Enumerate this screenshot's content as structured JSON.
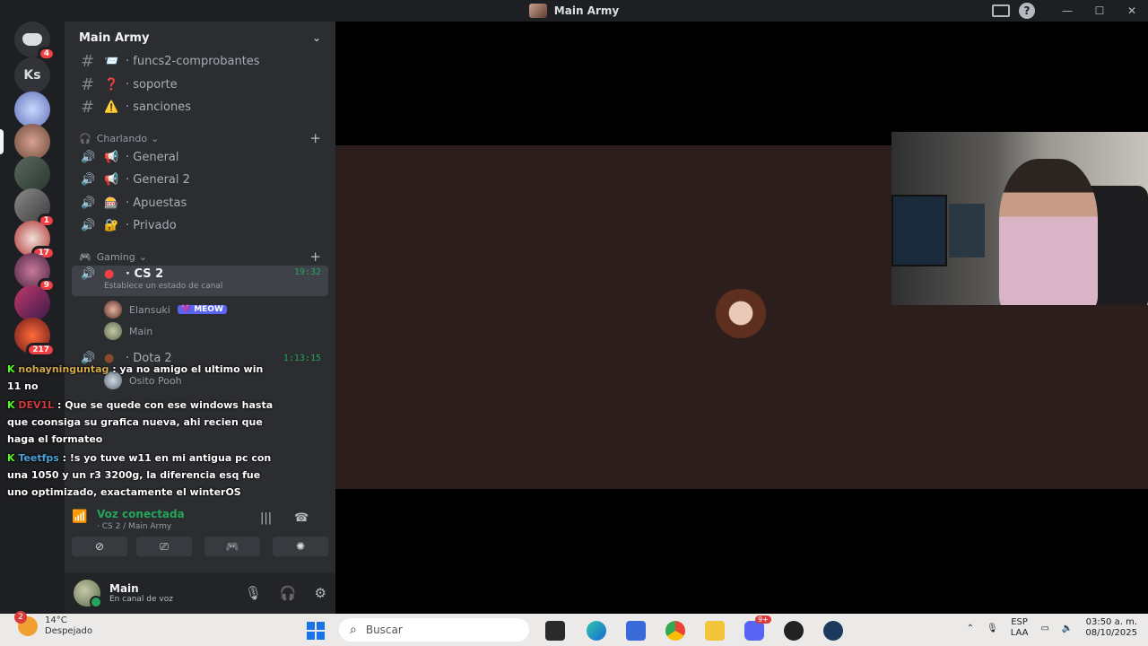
{
  "window": {
    "title": "Main Army"
  },
  "rail": {
    "dm_badge": "4",
    "ks_label": "Ks",
    "badges": [
      "1",
      "17",
      "9",
      "217"
    ]
  },
  "server": {
    "name": "Main Army",
    "text_channels": [
      {
        "emoji": "📨",
        "name": "· funcs2-comprobantes"
      },
      {
        "emoji": "❓",
        "name": "· soporte"
      },
      {
        "emoji": "⚠️",
        "name": "· sanciones"
      }
    ],
    "category_charlando": "Charlando",
    "voice_channels": [
      {
        "emoji": "📢",
        "name": "· General"
      },
      {
        "emoji": "📢",
        "name": "· General 2"
      },
      {
        "emoji": "🎰",
        "name": "· Apuestas"
      },
      {
        "emoji": "🔐",
        "name": "· Privado"
      }
    ],
    "category_gaming": "Gaming",
    "active_channel": {
      "name": "· CS 2",
      "timer": "19:32",
      "status": "Establece un estado de canal"
    },
    "cs2_users": [
      {
        "name": "Elansuki",
        "tag": "💜 MEOW"
      },
      {
        "name": "Main",
        "tag": ""
      }
    ],
    "dota": {
      "name": "· Dota 2",
      "timer": "1:13:15",
      "user": "Osito Pooh"
    }
  },
  "chat": [
    {
      "user": "nohayninguntag",
      "text": " : ya no amigo el ultimo win 11 no"
    },
    {
      "user": "DEV1L",
      "text": " : Que se quede con ese windows hasta que coonsiga su grafica nueva, ahi recien que haga el formateo"
    },
    {
      "user": "Teetfps",
      "text": " : !s yo tuve w11 en mi antigua pc con una 1050 y un r3 3200g, la diferencia esq fue uno optimizado, exactamente el winterOS"
    }
  ],
  "voice": {
    "title": "Voz conectada",
    "sub": "· CS 2 / Main Army"
  },
  "user": {
    "name": "Main",
    "status": "En canal de voz"
  },
  "taskbar": {
    "temp": "14°C",
    "weather": "Despejado",
    "weather_badge": "2",
    "search_placeholder": "Buscar",
    "lang1": "ESP",
    "lang2": "LAA",
    "time": "03:50 a. m.",
    "date": "08/10/2025",
    "discord_badge": "9+"
  }
}
